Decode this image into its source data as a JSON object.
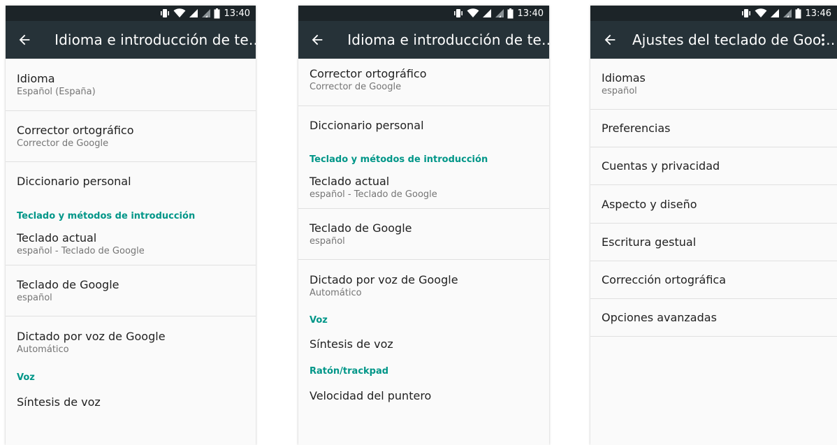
{
  "colors": {
    "appbar": "#263238",
    "statusbar": "#1c2428",
    "accent": "#009688",
    "background": "#fafafa"
  },
  "screens": [
    {
      "status": {
        "time": "13:40",
        "icons": [
          "vibrate-icon",
          "wifi-icon",
          "signal-icon",
          "signal-icon",
          "battery-icon"
        ]
      },
      "appbar": {
        "back_icon": "arrow-back-icon",
        "title": "Idioma e introducción de te…"
      },
      "items": [
        {
          "title": "Idioma",
          "subtitle": "Español (España)"
        },
        {
          "title": "Corrector ortográfico",
          "subtitle": "Corrector de Google"
        },
        {
          "title": "Diccionario personal"
        },
        {
          "section": "Teclado y métodos de introducción"
        },
        {
          "title": "Teclado actual",
          "subtitle": "español - Teclado de Google"
        },
        {
          "title": "Teclado de Google",
          "subtitle": "español"
        },
        {
          "title": "Dictado por voz de Google",
          "subtitle": "Automático"
        },
        {
          "section": "Voz"
        },
        {
          "title": "Síntesis de voz"
        }
      ]
    },
    {
      "status": {
        "time": "13:40",
        "icons": [
          "vibrate-icon",
          "wifi-icon",
          "signal-icon",
          "signal-icon",
          "battery-icon"
        ]
      },
      "appbar": {
        "back_icon": "arrow-back-icon",
        "title": "Idioma e introducción de te…"
      },
      "items": [
        {
          "title": "Corrector ortográfico",
          "subtitle": "Corrector de Google"
        },
        {
          "title": "Diccionario personal"
        },
        {
          "section": "Teclado y métodos de introducción"
        },
        {
          "title": "Teclado actual",
          "subtitle": "español - Teclado de Google"
        },
        {
          "title": "Teclado de Google",
          "subtitle": "español"
        },
        {
          "title": "Dictado por voz de Google",
          "subtitle": "Automático"
        },
        {
          "section": "Voz"
        },
        {
          "title": "Síntesis de voz"
        },
        {
          "section": "Ratón/trackpad"
        },
        {
          "title": "Velocidad del puntero"
        }
      ]
    },
    {
      "status": {
        "time": "13:46",
        "icons": [
          "vibrate-icon",
          "wifi-icon",
          "signal-icon",
          "signal-icon",
          "battery-icon"
        ]
      },
      "appbar": {
        "back_icon": "arrow-back-icon",
        "title": "Ajustes del teclado de Goo…",
        "menu_icon": "more-vert-icon"
      },
      "items": [
        {
          "title": "Idiomas",
          "subtitle": "español"
        },
        {
          "title": "Preferencias"
        },
        {
          "title": "Cuentas y privacidad"
        },
        {
          "title": "Aspecto y diseño"
        },
        {
          "title": "Escritura gestual"
        },
        {
          "title": "Corrección ortográfica"
        },
        {
          "title": "Opciones avanzadas"
        }
      ]
    }
  ]
}
